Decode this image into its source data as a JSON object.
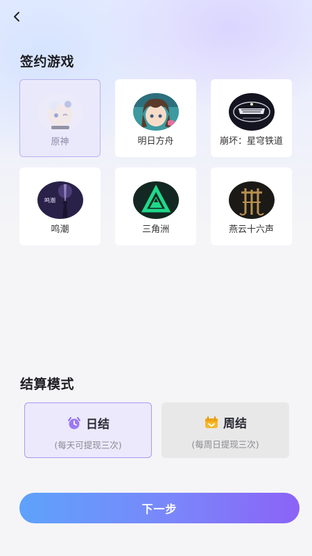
{
  "header": {
    "back_icon": "chevron-left-icon"
  },
  "games_section": {
    "title": "签约游戏",
    "games": [
      {
        "name": "原神",
        "selected": true
      },
      {
        "name": "明日方舟",
        "selected": false
      },
      {
        "name": "崩坏：星穹铁道",
        "selected": false
      },
      {
        "name": "鸣潮",
        "selected": false
      },
      {
        "name": "三角洲",
        "selected": false
      },
      {
        "name": "燕云十六声",
        "selected": false
      }
    ]
  },
  "settlement_section": {
    "title": "结算模式",
    "modes": [
      {
        "label": "日结",
        "desc": "(每天可提现三次)",
        "icon": "alarm-clock-icon",
        "selected": true
      },
      {
        "label": "周结",
        "desc": "(每周日提现三次)",
        "icon": "calendar-icon",
        "selected": false
      }
    ]
  },
  "actions": {
    "next_label": "下一步"
  },
  "colors": {
    "accent": "#8b63f7",
    "accent_start": "#5ea2fb",
    "selected_border": "#a79cf0",
    "clock_icon": "#8f6cf5",
    "calendar_icon": "#f5b82e"
  }
}
